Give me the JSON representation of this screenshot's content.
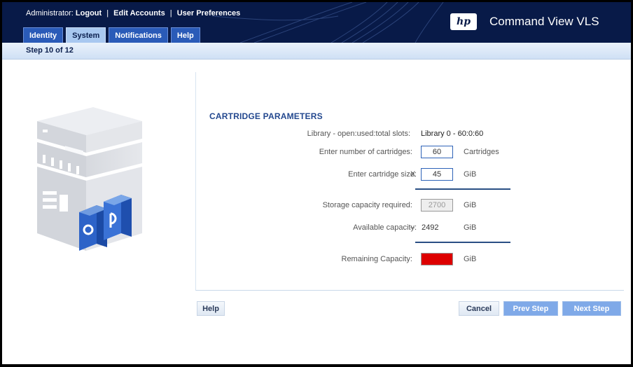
{
  "header": {
    "admin_prefix": "Administrator:",
    "links": [
      "Logout",
      "Edit Accounts",
      "User Preferences"
    ],
    "separator": "|",
    "brand_logo_text": "hp",
    "brand_title": "Command View VLS"
  },
  "tabs": [
    {
      "label": "Identity",
      "active": false
    },
    {
      "label": "System",
      "active": true
    },
    {
      "label": "Notifications",
      "active": false
    },
    {
      "label": "Help",
      "active": false
    }
  ],
  "step": "Step 10 of 12",
  "form": {
    "section_title": "CARTRIDGE PARAMETERS",
    "slots_label": "Library - open:used:total slots:",
    "slots_value": "Library 0 - 60:0:60",
    "num_cartridges_label": "Enter number of cartridges:",
    "num_cartridges_value": "60",
    "num_cartridges_unit": "Cartridges",
    "size_label": "Enter cartridge size:",
    "size_operator": "X",
    "size_value": "45",
    "size_unit": "GiB",
    "required_label": "Storage capacity required:",
    "required_value": "2700",
    "required_unit": "GiB",
    "available_label": "Available capacity:",
    "available_operator": "–",
    "available_value": "2492",
    "available_unit": "GiB",
    "remaining_label": "Remaining Capacity:",
    "remaining_unit": "GiB",
    "remaining_color": "#dd0000"
  },
  "buttons": {
    "help": "Help",
    "cancel": "Cancel",
    "prev": "Prev Step",
    "next": "Next Step"
  },
  "colors": {
    "header_bg": "#081a48",
    "accent_blue": "#7fa9e8",
    "title_blue": "#23488f"
  }
}
